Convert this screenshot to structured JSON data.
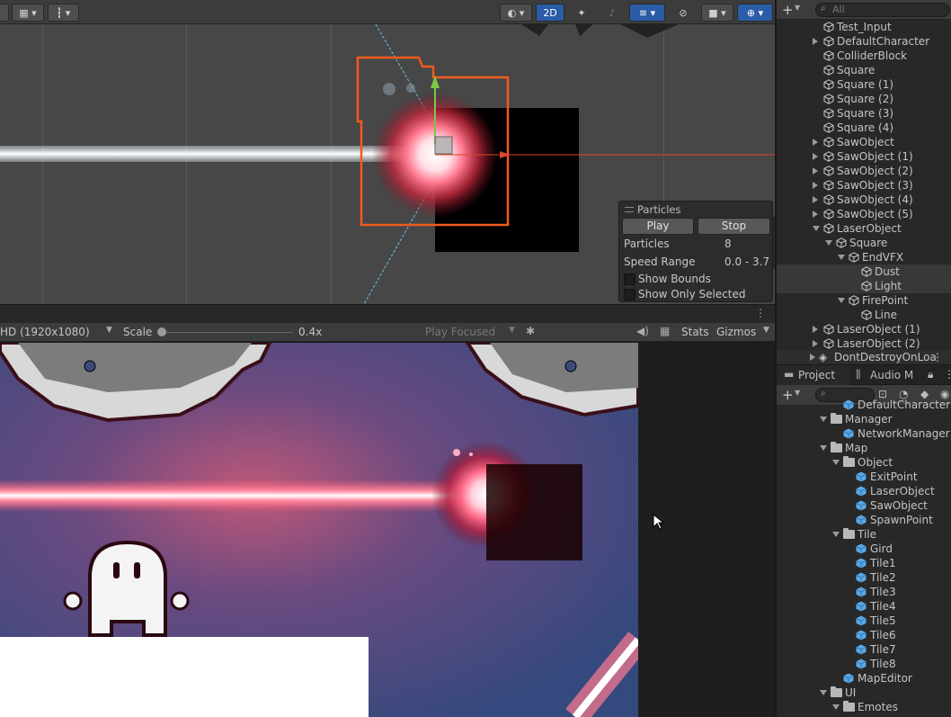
{
  "scene": {
    "toolbar": {
      "mode_2d": "2D"
    },
    "particles_panel": {
      "title": "Particles",
      "play_label": "Play",
      "stop_label": "Stop",
      "particles_label": "Particles",
      "particles_value": "8",
      "speed_range_label": "Speed Range",
      "speed_range_value": "0.0 - 3.7",
      "show_bounds_label": "Show Bounds",
      "show_only_selected_label": "Show Only Selected"
    }
  },
  "game": {
    "toolbar": {
      "resolution": "HD (1920x1080)",
      "scale_label": "Scale",
      "scale_value": "0.4x",
      "play_focused": "Play Focused",
      "stats_label": "Stats",
      "gizmos_label": "Gizmos"
    }
  },
  "hierarchy": {
    "search_placeholder": "All",
    "items": [
      {
        "label": "Test_Input",
        "indent": 0,
        "expand": "none"
      },
      {
        "label": "DefaultCharacter",
        "indent": 0,
        "expand": "collapsed"
      },
      {
        "label": "ColliderBlock",
        "indent": 0,
        "expand": "none"
      },
      {
        "label": "Square",
        "indent": 0,
        "expand": "none"
      },
      {
        "label": "Square (1)",
        "indent": 0,
        "expand": "none"
      },
      {
        "label": "Square (2)",
        "indent": 0,
        "expand": "none"
      },
      {
        "label": "Square (3)",
        "indent": 0,
        "expand": "none"
      },
      {
        "label": "Square (4)",
        "indent": 0,
        "expand": "none"
      },
      {
        "label": "SawObject",
        "indent": 0,
        "expand": "collapsed"
      },
      {
        "label": "SawObject (1)",
        "indent": 0,
        "expand": "collapsed"
      },
      {
        "label": "SawObject (2)",
        "indent": 0,
        "expand": "collapsed"
      },
      {
        "label": "SawObject (3)",
        "indent": 0,
        "expand": "collapsed"
      },
      {
        "label": "SawObject (4)",
        "indent": 0,
        "expand": "collapsed"
      },
      {
        "label": "SawObject (5)",
        "indent": 0,
        "expand": "collapsed"
      },
      {
        "label": "LaserObject",
        "indent": 0,
        "expand": "expanded"
      },
      {
        "label": "Square",
        "indent": 1,
        "expand": "expanded"
      },
      {
        "label": "EndVFX",
        "indent": 2,
        "expand": "expanded"
      },
      {
        "label": "Dust",
        "indent": 3,
        "expand": "none",
        "selected": true
      },
      {
        "label": "Light",
        "indent": 3,
        "expand": "none",
        "selected": true
      },
      {
        "label": "FirePoint",
        "indent": 2,
        "expand": "expanded"
      },
      {
        "label": "Line",
        "indent": 3,
        "expand": "none"
      },
      {
        "label": "LaserObject (1)",
        "indent": 0,
        "expand": "collapsed"
      },
      {
        "label": "LaserObject (2)",
        "indent": 0,
        "expand": "collapsed"
      }
    ],
    "scene_root": "DontDestroyOnLoa"
  },
  "project": {
    "tabs": {
      "project": "Project",
      "audio": "Audio M"
    },
    "items": [
      {
        "label": "DefaultCharacter",
        "indent": 2,
        "kind": "prefab",
        "expand": "none"
      },
      {
        "label": "Manager",
        "indent": 1,
        "kind": "folder",
        "expand": "expanded"
      },
      {
        "label": "NetworkManager",
        "indent": 2,
        "kind": "prefab",
        "expand": "none"
      },
      {
        "label": "Map",
        "indent": 1,
        "kind": "folder",
        "expand": "expanded"
      },
      {
        "label": "Object",
        "indent": 2,
        "kind": "folder",
        "expand": "expanded"
      },
      {
        "label": "ExitPoint",
        "indent": 3,
        "kind": "prefab",
        "expand": "none"
      },
      {
        "label": "LaserObject",
        "indent": 3,
        "kind": "prefab",
        "expand": "none"
      },
      {
        "label": "SawObject",
        "indent": 3,
        "kind": "prefab",
        "expand": "none"
      },
      {
        "label": "SpawnPoint",
        "indent": 3,
        "kind": "prefab",
        "expand": "none"
      },
      {
        "label": "Tile",
        "indent": 2,
        "kind": "folder",
        "expand": "expanded"
      },
      {
        "label": "Gird",
        "indent": 3,
        "kind": "prefab",
        "expand": "none"
      },
      {
        "label": "Tile1",
        "indent": 3,
        "kind": "prefab",
        "expand": "none"
      },
      {
        "label": "Tile2",
        "indent": 3,
        "kind": "prefab",
        "expand": "none"
      },
      {
        "label": "Tile3",
        "indent": 3,
        "kind": "prefab",
        "expand": "none"
      },
      {
        "label": "Tile4",
        "indent": 3,
        "kind": "prefab",
        "expand": "none"
      },
      {
        "label": "Tile5",
        "indent": 3,
        "kind": "prefab",
        "expand": "none"
      },
      {
        "label": "Tile6",
        "indent": 3,
        "kind": "prefab",
        "expand": "none"
      },
      {
        "label": "Tile7",
        "indent": 3,
        "kind": "prefab",
        "expand": "none"
      },
      {
        "label": "Tile8",
        "indent": 3,
        "kind": "prefab",
        "expand": "none"
      },
      {
        "label": "MapEditor",
        "indent": 2,
        "kind": "prefab",
        "expand": "none"
      },
      {
        "label": "UI",
        "indent": 1,
        "kind": "folder",
        "expand": "expanded"
      },
      {
        "label": "Emotes",
        "indent": 2,
        "kind": "folder",
        "expand": "expanded"
      }
    ]
  },
  "colors": {
    "selection_outline": "#f05a1e",
    "game_bg": "#3a4f83",
    "laser": "#ff5a78",
    "prefab_blue": "#5aa8e6"
  }
}
